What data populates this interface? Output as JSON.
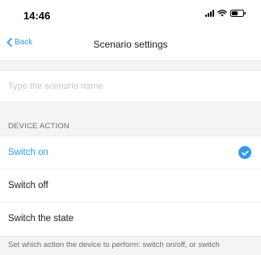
{
  "status_bar": {
    "time": "14:46"
  },
  "nav": {
    "back_label": "Back",
    "title": "Scenario settings"
  },
  "scenario_name": {
    "value": "",
    "placeholder": "Type the scenario name"
  },
  "device_action": {
    "header": "DEVICE ACTION",
    "options": [
      {
        "label": "Switch on",
        "selected": true
      },
      {
        "label": "Switch off",
        "selected": false
      },
      {
        "label": "Switch the state",
        "selected": false
      }
    ],
    "help_text": "Set which action the device to perform: switch on/off, or switch"
  },
  "colors": {
    "accent": "#2f9bf0",
    "background": "#f4f4f6",
    "surface": "#ffffff",
    "secondary_text": "#6d6d72",
    "placeholder": "#c4c7cc"
  },
  "icons": {
    "back": "chevron-left-icon",
    "selected": "checkmark-circle-icon",
    "signal": "cellular-signal-icon",
    "wifi": "wifi-icon",
    "battery": "battery-icon"
  }
}
